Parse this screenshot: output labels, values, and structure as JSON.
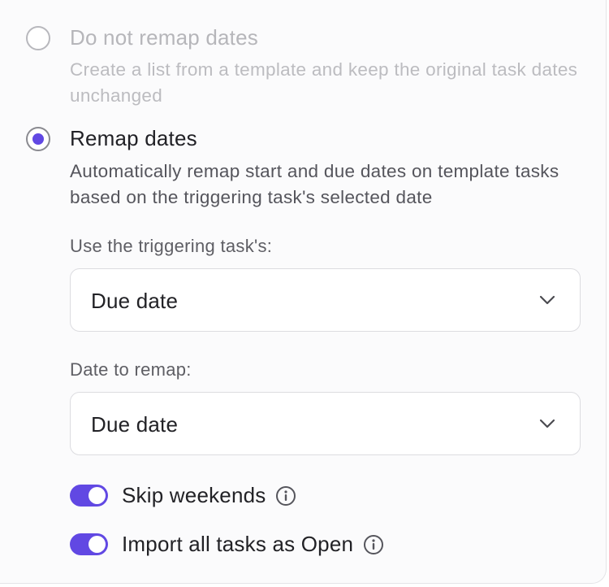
{
  "remap_options": {
    "no_remap": {
      "label": "Do not remap dates",
      "description": "Create a list from a template and keep the original task dates unchanged",
      "selected": false
    },
    "remap": {
      "label": "Remap dates",
      "description": "Automatically remap start and due dates on template tasks based on the triggering task's selected date",
      "selected": true
    }
  },
  "triggering_field": {
    "label": "Use the triggering task's:",
    "value": "Due date"
  },
  "remap_field": {
    "label": "Date to remap:",
    "value": "Due date"
  },
  "toggles": {
    "skip_weekends": {
      "label": "Skip weekends",
      "on": true,
      "icon": "info-icon"
    },
    "import_open": {
      "label": "Import all tasks as Open",
      "on": true,
      "icon": "info-icon"
    }
  },
  "colors": {
    "accent": "#6148e3",
    "disabled_text": "#b6b6ba",
    "primary_text": "#222226",
    "secondary_text": "#55555c"
  }
}
